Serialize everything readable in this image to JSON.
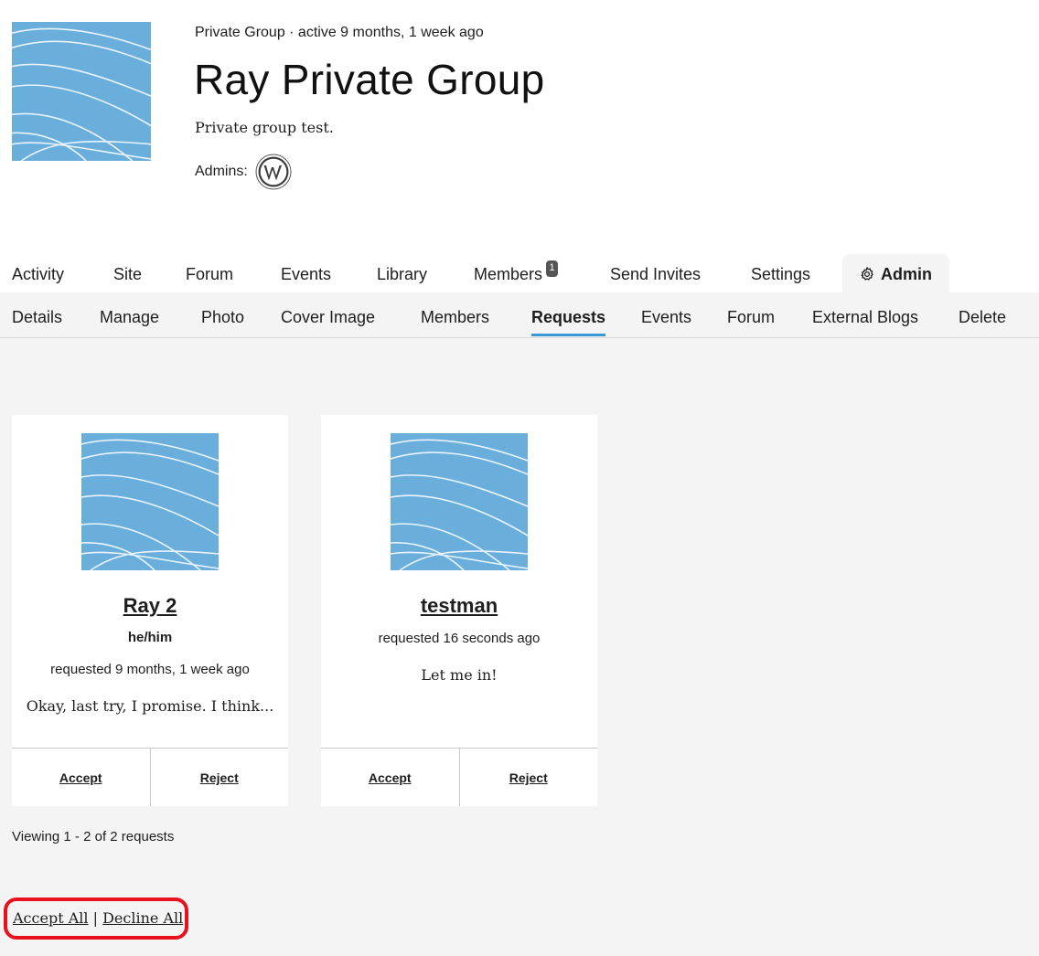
{
  "group": {
    "meta": "Private Group · active 9 months, 1 week ago",
    "title": "Ray Private Group",
    "description": "Private group test.",
    "admins_label": "Admins:"
  },
  "tabs": [
    {
      "label": "Activity"
    },
    {
      "label": "Site"
    },
    {
      "label": "Forum"
    },
    {
      "label": "Events"
    },
    {
      "label": "Library"
    },
    {
      "label": "Members",
      "badge": "1"
    },
    {
      "label": "Send Invites"
    },
    {
      "label": "Settings"
    },
    {
      "label": "Admin",
      "icon": "gear-icon",
      "active": true
    }
  ],
  "subtabs": [
    {
      "label": "Details"
    },
    {
      "label": "Manage"
    },
    {
      "label": "Photo"
    },
    {
      "label": "Cover Image"
    },
    {
      "label": "Members"
    },
    {
      "label": "Requests",
      "active": true
    },
    {
      "label": "Events"
    },
    {
      "label": "Forum"
    },
    {
      "label": "External Blogs"
    },
    {
      "label": "Delete"
    }
  ],
  "requests": [
    {
      "name": "Ray 2",
      "pronouns": "he/him",
      "time": "requested 9 months, 1 week ago",
      "message": "Okay, last try, I promise. I think...",
      "accept": "Accept",
      "reject": "Reject"
    },
    {
      "name": "testman",
      "time": "requested 16 seconds ago",
      "message": "Let me in!",
      "accept": "Accept",
      "reject": "Reject"
    }
  ],
  "viewing": "Viewing 1 - 2 of 2 requests",
  "bulk": {
    "accept_all": "Accept All",
    "separator": "|",
    "decline_all": "Decline All"
  },
  "colors": {
    "avatar": "#6aafdc",
    "tab_underline": "#3b98d6",
    "panel": "#f4f4f4",
    "highlight": "#e8121f"
  }
}
